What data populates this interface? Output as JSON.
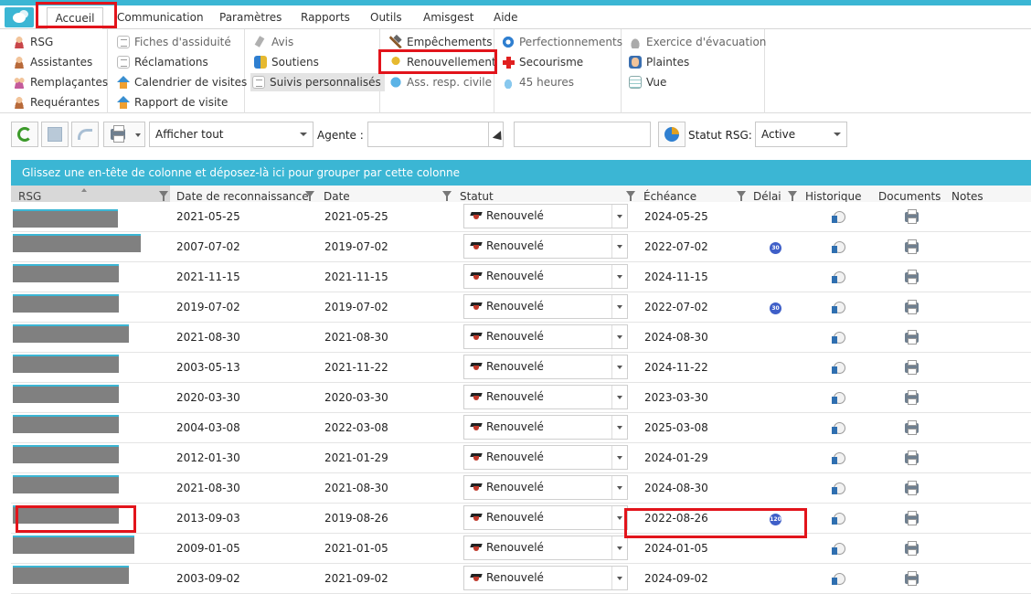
{
  "menu": {
    "tabs": [
      "Accueil",
      "Communication",
      "Paramètres",
      "Rapports",
      "Outils",
      "Amisgest",
      "Aide"
    ],
    "active_tab": "Accueil"
  },
  "ribbon": {
    "group1": [
      {
        "label": "RSG",
        "icon": "person-icon"
      },
      {
        "label": "Assistantes",
        "icon": "person-icon"
      },
      {
        "label": "Remplaçantes",
        "icon": "people-icon"
      },
      {
        "label": "Requérantes",
        "icon": "person-icon"
      }
    ],
    "group2": [
      {
        "label": "Fiches d'assiduité",
        "icon": "document-icon"
      },
      {
        "label": "Réclamations",
        "icon": "document-icon"
      },
      {
        "label": "Calendrier de visites",
        "icon": "house-icon"
      },
      {
        "label": "Rapport de visite",
        "icon": "house-icon"
      }
    ],
    "group3": [
      {
        "label": "Avis",
        "icon": "pin-icon"
      },
      {
        "label": "Soutiens",
        "icon": "flag-icon"
      },
      {
        "label": "Suivis personnalisés",
        "icon": "document-icon"
      }
    ],
    "group4": [
      {
        "label": "Empêchements",
        "icon": "hammer-icon"
      },
      {
        "label": "Renouvellement",
        "icon": "badge-icon"
      },
      {
        "label": "Ass. resp. civile",
        "icon": "globe-icon"
      }
    ],
    "group5": [
      {
        "label": "Perfectionnements",
        "icon": "swirl-icon"
      },
      {
        "label": "Secourisme",
        "icon": "red-cross-icon"
      },
      {
        "label": "45 heures",
        "icon": "drop-icon"
      }
    ],
    "group6": [
      {
        "label": "Exercice d'évacuation",
        "icon": "fire-icon"
      },
      {
        "label": "Plaintes",
        "icon": "complaint-icon"
      },
      {
        "label": "Vue",
        "icon": "grid-icon"
      }
    ]
  },
  "toolbar": {
    "filter_select": "Afficher tout",
    "agent_label": "Agente :",
    "agent_value": "",
    "search_value": "",
    "statut_label": "Statut RSG:",
    "statut_value": "Active"
  },
  "grid": {
    "group_hint": "Glissez une en-tête de colonne et déposez-là ici pour grouper par cette colonne",
    "columns": [
      "RSG",
      "Date de reconnaissance",
      "Date",
      "Statut",
      "Échéance",
      "Délai",
      "Historique",
      "Documents",
      "Notes"
    ],
    "rows": [
      {
        "reconnaissance": "2021-05-25",
        "date": "2021-05-25",
        "statut": "Renouvelé",
        "echeance": "2024-05-25",
        "delai": ""
      },
      {
        "reconnaissance": "2007-07-02",
        "date": "2019-07-02",
        "statut": "Renouvelé",
        "echeance": "2022-07-02",
        "delai": "30"
      },
      {
        "reconnaissance": "2021-11-15",
        "date": "2021-11-15",
        "statut": "Renouvelé",
        "echeance": "2024-11-15",
        "delai": ""
      },
      {
        "reconnaissance": "2019-07-02",
        "date": "2019-07-02",
        "statut": "Renouvelé",
        "echeance": "2022-07-02",
        "delai": "30"
      },
      {
        "reconnaissance": "2021-08-30",
        "date": "2021-08-30",
        "statut": "Renouvelé",
        "echeance": "2024-08-30",
        "delai": ""
      },
      {
        "reconnaissance": "2003-05-13",
        "date": "2021-11-22",
        "statut": "Renouvelé",
        "echeance": "2024-11-22",
        "delai": ""
      },
      {
        "reconnaissance": "2020-03-30",
        "date": "2020-03-30",
        "statut": "Renouvelé",
        "echeance": "2023-03-30",
        "delai": ""
      },
      {
        "reconnaissance": "2004-03-08",
        "date": "2022-03-08",
        "statut": "Renouvelé",
        "echeance": "2025-03-08",
        "delai": ""
      },
      {
        "reconnaissance": "2012-01-30",
        "date": "2021-01-29",
        "statut": "Renouvelé",
        "echeance": "2024-01-29",
        "delai": ""
      },
      {
        "reconnaissance": "2021-08-30",
        "date": "2021-08-30",
        "statut": "Renouvelé",
        "echeance": "2024-08-30",
        "delai": ""
      },
      {
        "reconnaissance": "2013-09-03",
        "date": "2019-08-26",
        "statut": "Renouvelé",
        "echeance": "2022-08-26",
        "delai": "120"
      },
      {
        "reconnaissance": "2009-01-05",
        "date": "2021-01-05",
        "statut": "Renouvelé",
        "echeance": "2024-01-05",
        "delai": ""
      },
      {
        "reconnaissance": "2003-09-02",
        "date": "2021-09-02",
        "statut": "Renouvelé",
        "echeance": "2024-09-02",
        "delai": ""
      }
    ]
  },
  "colors": {
    "accent": "#3bb6d4",
    "highlight": "#e2141b"
  }
}
